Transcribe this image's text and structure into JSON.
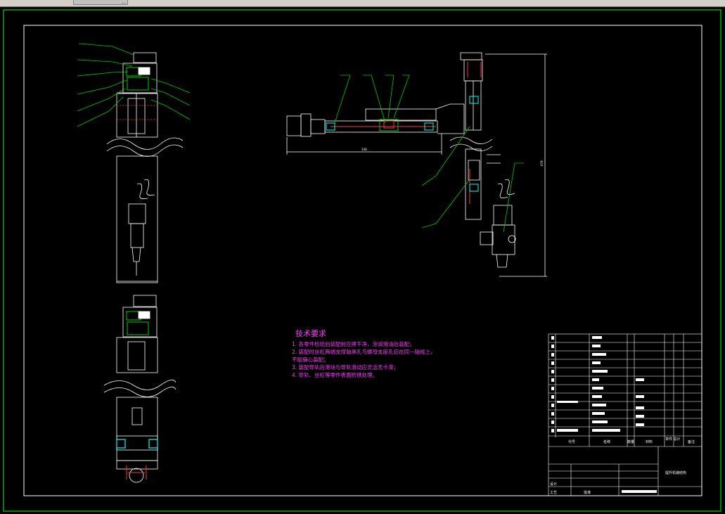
{
  "window": {
    "tab_label": "…"
  },
  "drawing": {
    "dimension_labels": {
      "horizontal_span": "348",
      "vertical_span": "678"
    }
  },
  "technical_requirements": {
    "title": "技术要求",
    "items": [
      "1. 各零件检验后装配前应擦干净，涂润滑油后装配；",
      "2. 装配时丝杠两端支撑轴承孔与螺母支座孔应在同一轴线上，",
      "不能偏心装配；",
      "3. 装配导轨后滑块与导轨滑动应灵活无卡滞；",
      "4. 导轨、丝杠等零件表面防锈处理。"
    ]
  },
  "title_block": {
    "drawing_title": "提升机械结构",
    "parts_header": {
      "code": "代号",
      "name": "名称",
      "qty": "数量",
      "material": "材料",
      "weight": "单件 总计",
      "notes": "备注"
    },
    "label_design": "设计",
    "label_process": "工艺",
    "label_approve": "批准"
  },
  "colors": {
    "background": "#000000",
    "line_white": "#ffffff",
    "leader_green": "#00cc00",
    "part_red": "#ff3333",
    "part_cyan": "#00ffff",
    "note_magenta": "#ff33ff",
    "frame_green": "#00ff00"
  }
}
